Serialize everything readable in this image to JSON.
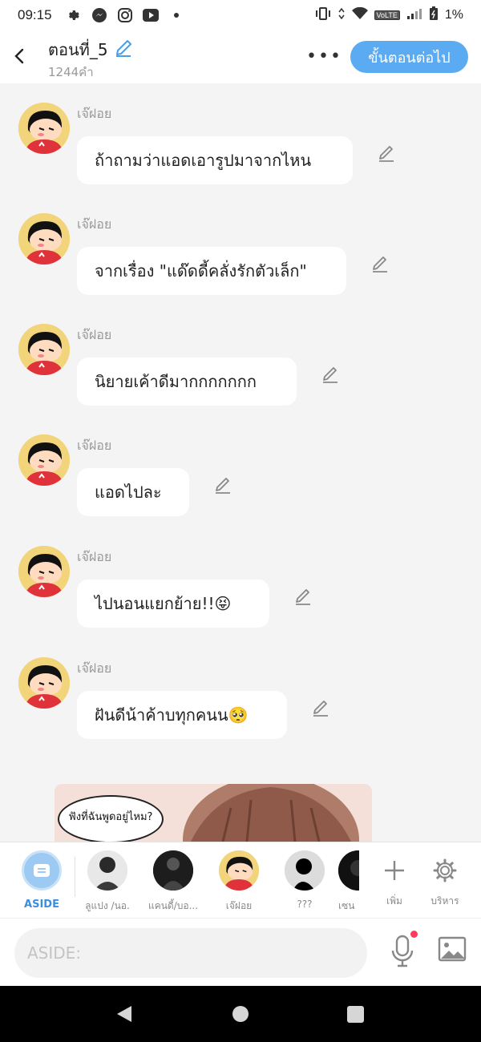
{
  "status_bar": {
    "time": "09:15",
    "battery": "1%",
    "network": "VoLTE"
  },
  "header": {
    "title": "ตอนที่_5",
    "word_count": "1244คำ",
    "more_label": "•••",
    "next_button": "ขั้นตอนต่อไป"
  },
  "messages": [
    {
      "sender": "เจ๊ฝอย",
      "text": "ถ้าถามว่าแอดเอารูปมาจากไหน"
    },
    {
      "sender": "เจ๊ฝอย",
      "text": "จากเรื่อง \"แด๊ดดี้คลั่งรักตัวเล็ก\""
    },
    {
      "sender": "เจ๊ฝอย",
      "text": "นิยายเค้าดีมากกกกกกก"
    },
    {
      "sender": "เจ๊ฝอย",
      "text": "แอดไปละ"
    },
    {
      "sender": "เจ๊ฝอย",
      "text": "ไปนอนแยกย้าย!!😝"
    },
    {
      "sender": "เจ๊ฝอย",
      "text": "ฝันดีน้าค้าบทุกคนน🥺"
    }
  ],
  "image_preview": {
    "speech_text": "ฟังที่ฉันพูดอยู่ไหม?"
  },
  "characters": {
    "aside_label": "ASIDE",
    "items": [
      {
        "label": "ลูแปง /นอ."
      },
      {
        "label": "แคนดี้/บอ..."
      },
      {
        "label": "เจ๊ฝอย"
      },
      {
        "label": "???"
      },
      {
        "label": "เซน"
      }
    ],
    "add_label": "เพิ่ม",
    "manage_label": "บริหาร"
  },
  "input": {
    "placeholder": "ASIDE:"
  },
  "colors": {
    "accent": "#5aabf2",
    "aside_blue": "#3a8ee0",
    "mic_dot": "#ff3b5c"
  }
}
